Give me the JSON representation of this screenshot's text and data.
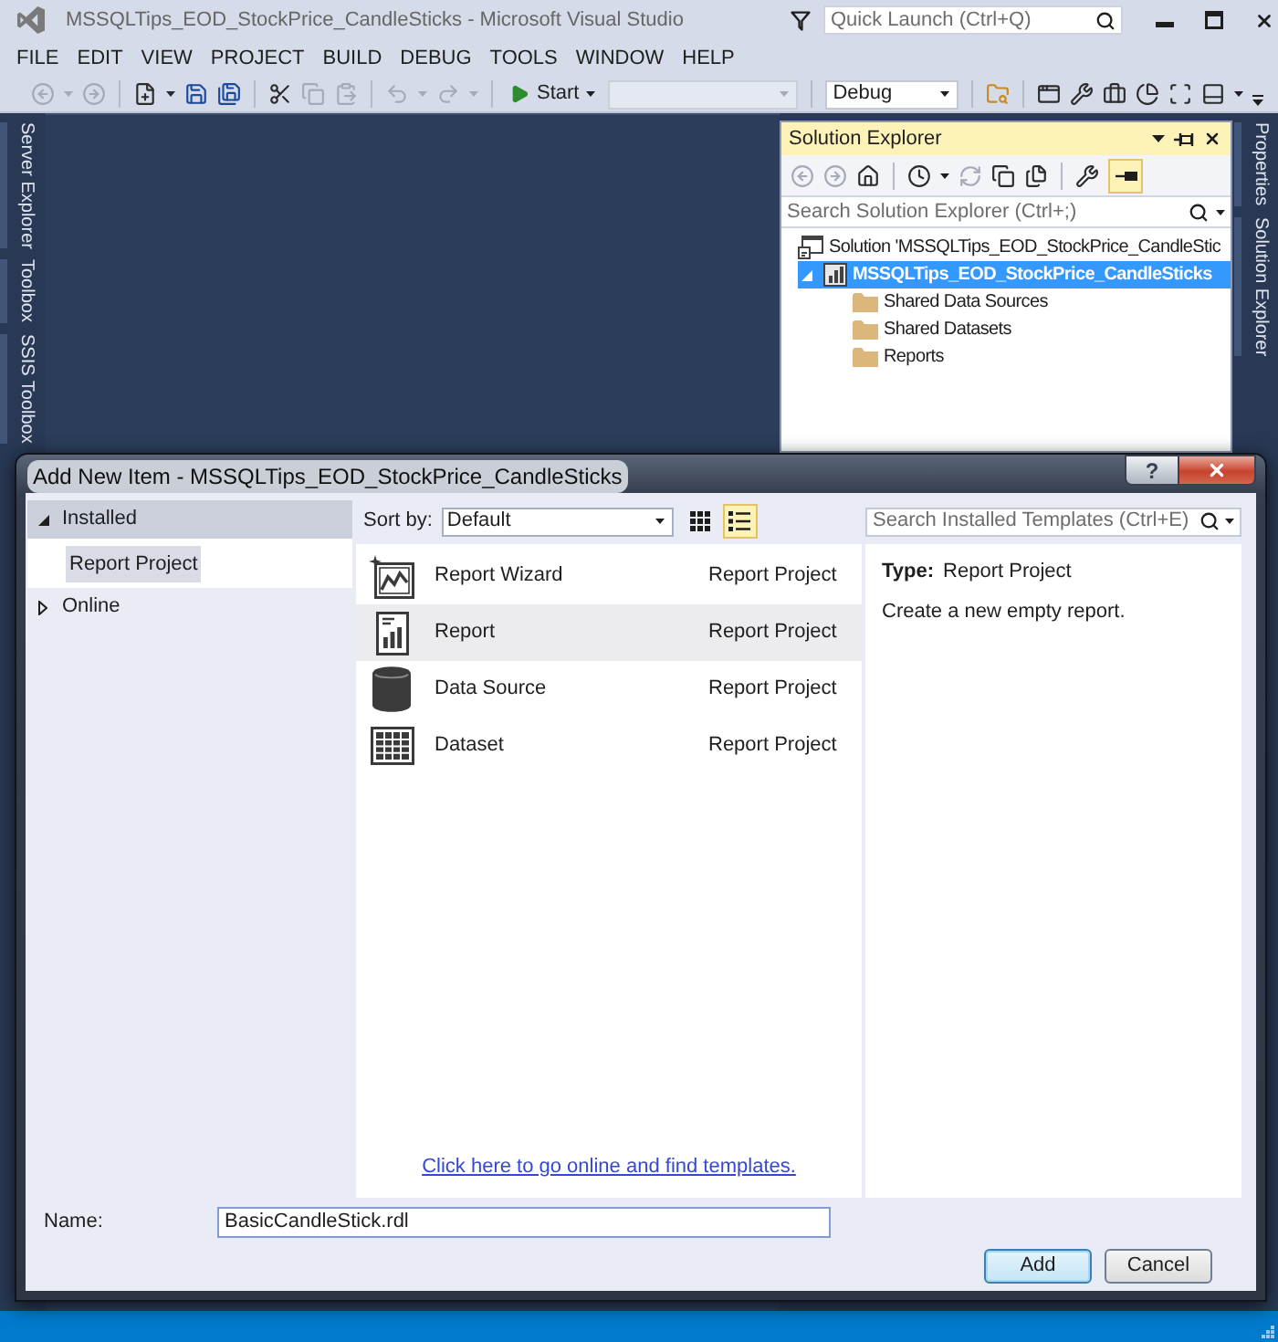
{
  "window": {
    "title": "MSSQLTips_EOD_StockPrice_CandleSticks - Microsoft Visual Studio",
    "active": false
  },
  "quick_launch": {
    "placeholder": "Quick Launch (Ctrl+Q)"
  },
  "menu": [
    "FILE",
    "EDIT",
    "VIEW",
    "PROJECT",
    "BUILD",
    "DEBUG",
    "TOOLS",
    "WINDOW",
    "HELP"
  ],
  "toolbar": {
    "start_label": "Start",
    "target_combo": {
      "disabled": true
    },
    "configuration": "Debug"
  },
  "left_tabs": [
    "Server Explorer",
    "Toolbox",
    "SSIS Toolbox"
  ],
  "right_tabs": [
    "Properties",
    "Solution Explorer"
  ],
  "solution_explorer": {
    "title": "Solution Explorer",
    "toggle_button": {
      "on": true
    },
    "search": {
      "placeholder": "Search Solution Explorer (Ctrl+;)"
    },
    "tree": [
      {
        "kind": "solution",
        "label": "Solution 'MSSQLTips_EOD_StockPrice_CandleStic",
        "selected": false,
        "children": [
          {
            "kind": "project",
            "label": "MSSQLTips_EOD_StockPrice_CandleSticks",
            "selected": true,
            "expanded": true,
            "children": [
              {
                "kind": "folder",
                "label": "Shared Data Sources",
                "selected": false
              },
              {
                "kind": "folder",
                "label": "Shared Datasets",
                "selected": false
              },
              {
                "kind": "folder",
                "label": "Reports",
                "selected": false
              }
            ]
          }
        ]
      }
    ]
  },
  "dialog": {
    "title": "Add New Item - MSSQLTips_EOD_StockPrice_CandleSticks",
    "help_label": "?",
    "categories": [
      {
        "label": "Installed",
        "expanded": true,
        "selected": false,
        "children": [
          {
            "label": "Report Project",
            "selected": true
          }
        ]
      },
      {
        "label": "Online",
        "expanded": false,
        "selected": false
      }
    ],
    "sort": {
      "label": "Sort by:",
      "value": "Default"
    },
    "view_buttons": [
      {
        "kind": "grid",
        "selected": false
      },
      {
        "kind": "list",
        "selected": true
      }
    ],
    "search": {
      "placeholder": "Search Installed Templates (Ctrl+E)"
    },
    "templates": [
      {
        "kind": "wizard",
        "name": "Report Wizard",
        "type": "Report Project",
        "selected": false
      },
      {
        "kind": "report",
        "name": "Report",
        "type": "Report Project",
        "selected": true
      },
      {
        "kind": "data_source",
        "name": "Data Source",
        "type": "Report Project",
        "selected": false
      },
      {
        "kind": "dataset",
        "name": "Dataset",
        "type": "Report Project",
        "selected": false
      }
    ],
    "details": {
      "type_label": "Type:",
      "type_value": "Report Project",
      "description": "Create a new empty report."
    },
    "online_link": "Click here to go online and find templates.",
    "name_field": {
      "label": "Name:",
      "value": "BasicCandleStick.rdl"
    },
    "buttons": [
      {
        "label": "Add",
        "default": true
      },
      {
        "label": "Cancel",
        "default": false
      }
    ]
  }
}
